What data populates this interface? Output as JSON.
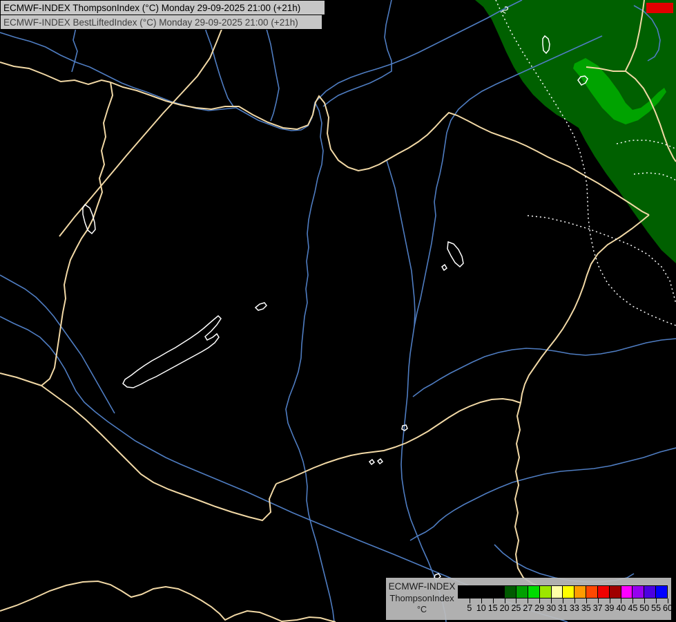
{
  "title_bar": {
    "line1": "ECMWF-INDEX ThompsonIndex (°C) Monday 29-09-2025 21:00 (+21h)",
    "line2": "ECMWF-INDEX BestLiftedIndex (°C) Monday 29-09-2025 21:00 (+21h)"
  },
  "map": {
    "contour_label": "2",
    "colors": {
      "background": "#000000",
      "border": "#f2d9a6",
      "river": "#4f7dc2",
      "lake_outline": "#ffffff",
      "contour": "#ffffff",
      "region_20_25": "#006000",
      "region_25_27": "#00a300",
      "logo_red": "#e10000"
    }
  },
  "legend": {
    "title_lines": [
      "ECMWF-INDEX",
      "ThompsonIndex",
      "°C"
    ],
    "background": "#bdbdbd",
    "cell_colors": [
      "#000000",
      "#000000",
      "#000000",
      "#000000",
      "#005a00",
      "#00a000",
      "#00dc00",
      "#9ce600",
      "#ffffa8",
      "#ffff00",
      "#ff9c00",
      "#ff4800",
      "#f00000",
      "#a00000",
      "#ff00ff",
      "#9600f0",
      "#4b00e1",
      "#0000ff"
    ],
    "ticks": [
      5,
      10,
      15,
      20,
      25,
      27,
      29,
      30,
      31,
      33,
      35,
      37,
      39,
      40,
      45,
      50,
      55,
      60
    ]
  },
  "chart_data": {
    "type": "heatmap",
    "title": "ECMWF-INDEX ThompsonIndex (°C)",
    "valid_time": "Monday 29-09-2025 21:00 (+21h)",
    "scale_unit": "°C",
    "scale_bounds": [
      5,
      10,
      15,
      20,
      25,
      27,
      29,
      30,
      31,
      33,
      35,
      37,
      39,
      40,
      45,
      50,
      55,
      60
    ],
    "scale_colors": [
      "#000000",
      "#000000",
      "#000000",
      "#000000",
      "#005a00",
      "#00a000",
      "#00dc00",
      "#9ce600",
      "#ffffa8",
      "#ffff00",
      "#ff9c00",
      "#ff4800",
      "#f00000",
      "#a00000",
      "#ff00ff",
      "#9600f0",
      "#4b00e1",
      "#0000ff"
    ],
    "regions_shown": [
      {
        "band": "20-25",
        "color": "#006000",
        "location": "upper-right of map"
      },
      {
        "band": "25-27",
        "color": "#00a300",
        "location": "patch inside upper-right region"
      }
    ],
    "contour_labels": [
      "2"
    ]
  }
}
